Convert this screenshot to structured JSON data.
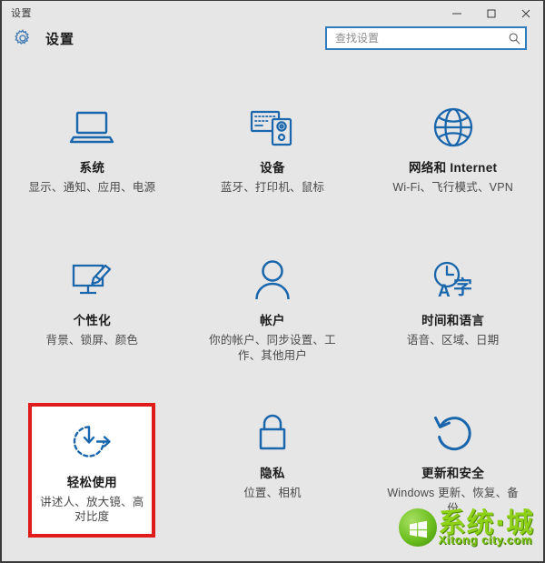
{
  "window": {
    "titlebar_label": "设置",
    "controls": {
      "minimize": "−",
      "maximize": "□",
      "close": "✕"
    }
  },
  "header": {
    "gear_icon": "gear-icon",
    "app_title": "设置"
  },
  "search": {
    "placeholder": "查找设置",
    "value": "",
    "icon": "search-icon"
  },
  "colors": {
    "accent_blue": "#1a66ad",
    "search_border": "#2e7bbf",
    "highlight_red": "#e01b1b",
    "window_bg": "#e6e6e6"
  },
  "tiles": [
    {
      "id": "system",
      "icon": "laptop-icon",
      "title": "系统",
      "desc": "显示、通知、应用、电源",
      "highlighted": false
    },
    {
      "id": "devices",
      "icon": "keyboard-device-icon",
      "title": "设备",
      "desc": "蓝牙、打印机、鼠标",
      "highlighted": false
    },
    {
      "id": "network-internet",
      "icon": "globe-icon",
      "title": "网络和 Internet",
      "desc": "Wi-Fi、飞行模式、VPN",
      "highlighted": false
    },
    {
      "id": "personalization",
      "icon": "monitor-brush-icon",
      "title": "个性化",
      "desc": "背景、锁屏、颜色",
      "highlighted": false
    },
    {
      "id": "accounts",
      "icon": "person-icon",
      "title": "帐户",
      "desc": "你的帐户、同步设置、工作、其他用户",
      "highlighted": false
    },
    {
      "id": "time-language",
      "icon": "clock-language-icon",
      "title": "时间和语言",
      "desc": "语音、区域、日期",
      "highlighted": false
    },
    {
      "id": "ease-of-access",
      "icon": "ease-of-access-icon",
      "title": "轻松使用",
      "desc": "讲述人、放大镜、高对比度",
      "highlighted": true
    },
    {
      "id": "privacy",
      "icon": "lock-icon",
      "title": "隐私",
      "desc": "位置、相机",
      "highlighted": false
    },
    {
      "id": "update-security",
      "icon": "refresh-arrow-icon",
      "title": "更新和安全",
      "desc": "Windows 更新、恢复、备份",
      "highlighted": false
    }
  ],
  "watermark": {
    "cn_text": "系统·城",
    "en_text": "Xitong city.com"
  }
}
